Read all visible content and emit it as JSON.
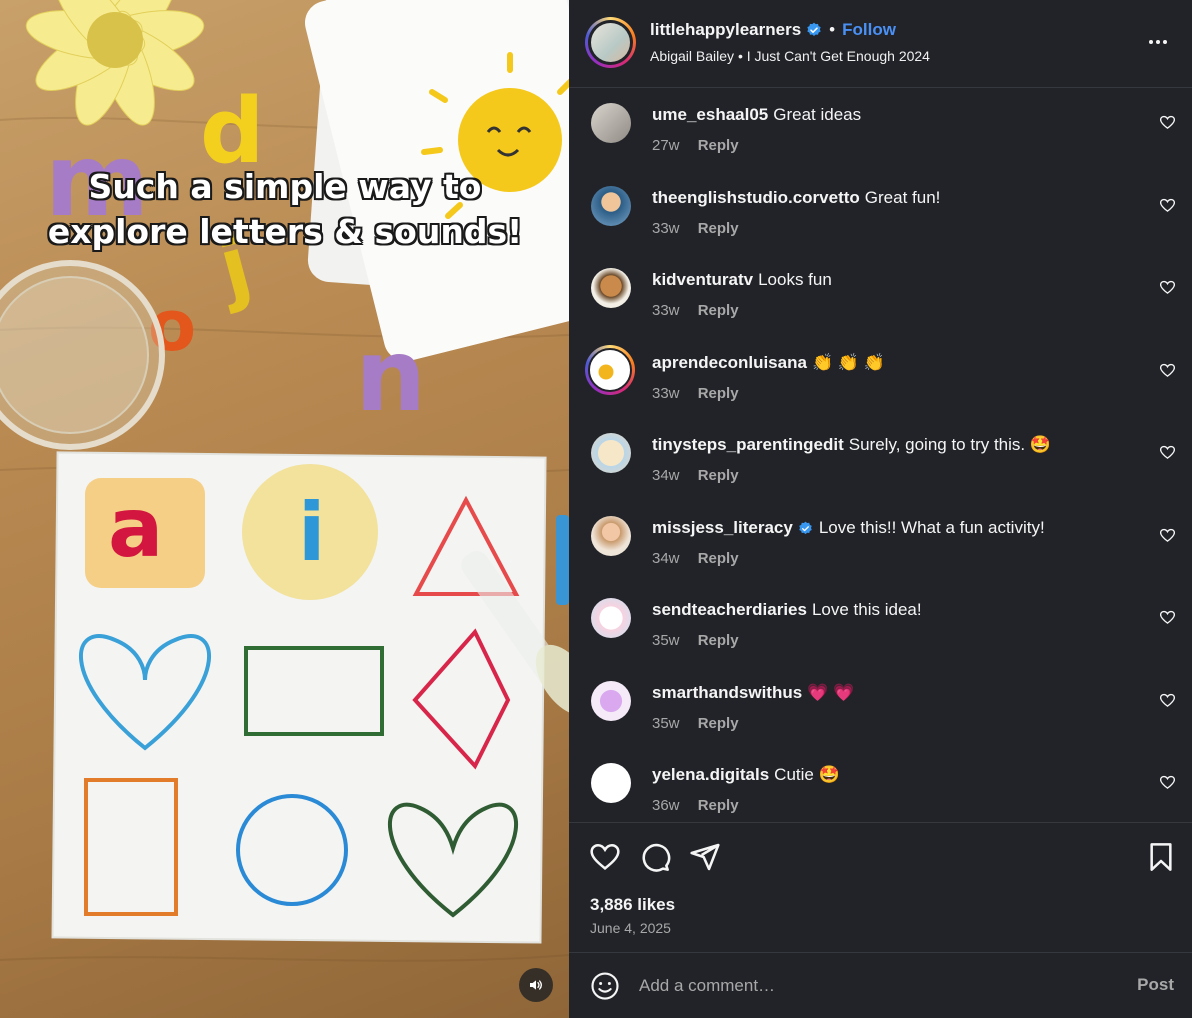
{
  "media": {
    "caption_line1": "Such a simple way to",
    "caption_line2": "explore letters & sounds!"
  },
  "header": {
    "username": "littlehappylearners",
    "separator": "•",
    "follow_label": "Follow",
    "audio_info": "Abigail Bailey • I Just Can't Get Enough 2024"
  },
  "comments": [
    {
      "user": "ume_eshaal05",
      "text": "Great ideas",
      "time": "27w",
      "reply": "Reply",
      "verified": false
    },
    {
      "user": "theenglishstudio.corvetto",
      "text": "Great fun!",
      "time": "33w",
      "reply": "Reply",
      "verified": false
    },
    {
      "user": "kidventuratv",
      "text": "Looks fun",
      "time": "33w",
      "reply": "Reply",
      "verified": false
    },
    {
      "user": "aprendeconluisana",
      "text": "👏 👏 👏",
      "time": "33w",
      "reply": "Reply",
      "verified": false
    },
    {
      "user": "tinysteps_parentingedit",
      "text": "Surely, going to try this. 🤩",
      "time": "34w",
      "reply": "Reply",
      "verified": false
    },
    {
      "user": "missjess_literacy",
      "text": "Love this!! What a fun activity!",
      "time": "34w",
      "reply": "Reply",
      "verified": true
    },
    {
      "user": "sendteacherdiaries",
      "text": "Love this idea!",
      "time": "35w",
      "reply": "Reply",
      "verified": false
    },
    {
      "user": "smarthandswithus",
      "text": "💗 💗",
      "time": "35w",
      "reply": "Reply",
      "verified": false
    },
    {
      "user": "yelena.digitals",
      "text": "Cutie 🤩",
      "time": "36w",
      "reply": "Reply",
      "verified": false
    }
  ],
  "footer": {
    "likes": "3,886 likes",
    "date": "June 4, 2025",
    "comment_placeholder": "Add a comment…",
    "post_label": "Post"
  },
  "colors": {
    "background": "#212328",
    "follow": "#4a90f5",
    "muted_text": "#a8a8a8",
    "verified_badge": "#3897f0"
  }
}
